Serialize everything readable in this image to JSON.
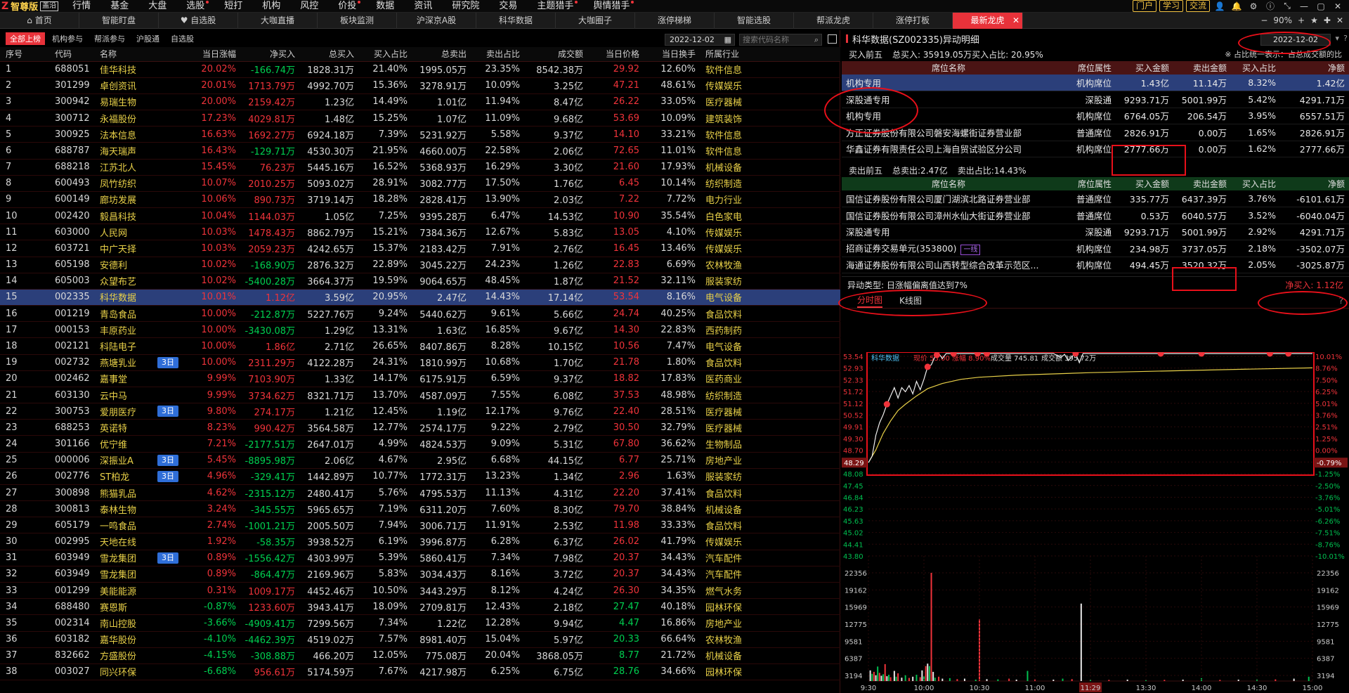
{
  "app": {
    "logo_mark": "Z",
    "name": "智尊版",
    "version": "盖沿"
  },
  "menu": [
    {
      "label": "行情",
      "dot": false
    },
    {
      "label": "基金",
      "dot": false
    },
    {
      "label": "大盘",
      "dot": false
    },
    {
      "label": "选股",
      "dot": true
    },
    {
      "label": "短打",
      "dot": false
    },
    {
      "label": "机构",
      "dot": false
    },
    {
      "label": "风控",
      "dot": false
    },
    {
      "label": "价投",
      "dot": true
    },
    {
      "label": "数据",
      "dot": false
    },
    {
      "label": "资讯",
      "dot": false
    },
    {
      "label": "研究院",
      "dot": false
    },
    {
      "label": "交易",
      "dot": false
    },
    {
      "label": "主题猎手",
      "dot": true
    },
    {
      "label": "舆情猎手",
      "dot": true
    }
  ],
  "menu_right": {
    "portal": "门户",
    "learn": "学习",
    "exchange": "交流"
  },
  "tabs": [
    "首页",
    "智能盯盘",
    "自选股",
    "大咖直播",
    "板块监测",
    "沪深京A股",
    "科华数据",
    "大咖圈子",
    "涨停梯梯",
    "智能选股",
    "帮派龙虎",
    "涨停打板",
    "最新龙虎"
  ],
  "tabbar_right": {
    "zoom": "90%"
  },
  "left": {
    "subtabs": [
      "全部上榜",
      "机构参与",
      "帮派参与",
      "沪股通",
      "自选股"
    ],
    "date": "2022-12-02",
    "search_placeholder": "搜索代码名称",
    "columns": [
      "序号",
      "代码",
      "名称",
      "当日涨幅",
      "净买入",
      "总买入",
      "买入占比",
      "总卖出",
      "卖出占比",
      "成交额",
      "当日价格",
      "当日换手",
      "所属行业"
    ],
    "rows": [
      [
        "1",
        "688051",
        "佳华科技",
        "",
        "20.02%",
        "-166.74万",
        "1828.31万",
        "21.40%",
        "1995.05万",
        "23.35%",
        "8542.38万",
        "29.92",
        "12.60%",
        "软件信息"
      ],
      [
        "2",
        "301299",
        "卓创资讯",
        "",
        "20.01%",
        "1713.79万",
        "4992.70万",
        "15.36%",
        "3278.91万",
        "10.09%",
        "3.25亿",
        "47.21",
        "48.61%",
        "传媒娱乐"
      ],
      [
        "3",
        "300942",
        "易瑞生物",
        "",
        "20.00%",
        "2159.42万",
        "1.23亿",
        "14.49%",
        "1.01亿",
        "11.94%",
        "8.47亿",
        "26.22",
        "33.05%",
        "医疗器械"
      ],
      [
        "4",
        "300712",
        "永福股份",
        "",
        "17.23%",
        "4029.81万",
        "1.48亿",
        "15.25%",
        "1.07亿",
        "11.09%",
        "9.68亿",
        "53.69",
        "10.09%",
        "建筑装饰"
      ],
      [
        "5",
        "300925",
        "法本信息",
        "",
        "16.63%",
        "1692.27万",
        "6924.18万",
        "7.39%",
        "5231.92万",
        "5.58%",
        "9.37亿",
        "14.10",
        "33.21%",
        "软件信息"
      ],
      [
        "6",
        "688787",
        "海天瑞声",
        "",
        "16.43%",
        "-129.71万",
        "4530.30万",
        "21.95%",
        "4660.00万",
        "22.58%",
        "2.06亿",
        "72.65",
        "11.01%",
        "软件信息"
      ],
      [
        "7",
        "688218",
        "江苏北人",
        "",
        "15.45%",
        "76.23万",
        "5445.16万",
        "16.52%",
        "5368.93万",
        "16.29%",
        "3.30亿",
        "21.60",
        "17.93%",
        "机械设备"
      ],
      [
        "8",
        "600493",
        "凤竹纺织",
        "",
        "10.07%",
        "2010.25万",
        "5093.02万",
        "28.91%",
        "3082.77万",
        "17.50%",
        "1.76亿",
        "6.45",
        "10.14%",
        "纺织制造"
      ],
      [
        "9",
        "600149",
        "廊坊发展",
        "",
        "10.06%",
        "890.73万",
        "3719.14万",
        "18.28%",
        "2828.41万",
        "13.90%",
        "2.03亿",
        "7.22",
        "7.72%",
        "电力行业"
      ],
      [
        "10",
        "002420",
        "毅昌科技",
        "",
        "10.04%",
        "1144.03万",
        "1.05亿",
        "7.25%",
        "9395.28万",
        "6.47%",
        "14.53亿",
        "10.90",
        "35.54%",
        "白色家电"
      ],
      [
        "11",
        "603000",
        "人民网",
        "",
        "10.03%",
        "1478.43万",
        "8862.79万",
        "15.21%",
        "7384.36万",
        "12.67%",
        "5.83亿",
        "13.05",
        "4.10%",
        "传媒娱乐"
      ],
      [
        "12",
        "603721",
        "中广天择",
        "",
        "10.03%",
        "2059.23万",
        "4242.65万",
        "15.37%",
        "2183.42万",
        "7.91%",
        "2.76亿",
        "16.45",
        "13.46%",
        "传媒娱乐"
      ],
      [
        "13",
        "605198",
        "安德利",
        "",
        "10.02%",
        "-168.90万",
        "2876.32万",
        "22.89%",
        "3045.22万",
        "24.23%",
        "1.26亿",
        "22.83",
        "6.69%",
        "农林牧渔"
      ],
      [
        "14",
        "605003",
        "众望布艺",
        "",
        "10.02%",
        "-5400.28万",
        "3664.37万",
        "19.59%",
        "9064.65万",
        "48.45%",
        "1.87亿",
        "21.52",
        "32.11%",
        "服装家纺"
      ],
      [
        "15",
        "002335",
        "科华数据",
        "",
        "10.01%",
        "1.12亿",
        "3.59亿",
        "20.95%",
        "2.47亿",
        "14.43%",
        "17.14亿",
        "53.54",
        "8.16%",
        "电气设备"
      ],
      [
        "16",
        "001219",
        "青岛食品",
        "",
        "10.00%",
        "-212.87万",
        "5227.76万",
        "9.24%",
        "5440.62万",
        "9.61%",
        "5.66亿",
        "24.74",
        "40.25%",
        "食品饮料"
      ],
      [
        "17",
        "000153",
        "丰原药业",
        "",
        "10.00%",
        "-3430.08万",
        "1.29亿",
        "13.31%",
        "1.63亿",
        "16.85%",
        "9.67亿",
        "14.30",
        "22.83%",
        "西药制药"
      ],
      [
        "18",
        "002121",
        "科陆电子",
        "",
        "10.00%",
        "1.86亿",
        "2.71亿",
        "26.65%",
        "8407.86万",
        "8.28%",
        "10.15亿",
        "10.56",
        "7.47%",
        "电气设备"
      ],
      [
        "19",
        "002732",
        "燕塘乳业",
        "3日",
        "10.00%",
        "2311.29万",
        "4122.28万",
        "24.31%",
        "1810.99万",
        "10.68%",
        "1.70亿",
        "21.78",
        "1.80%",
        "食品饮料"
      ],
      [
        "20",
        "002462",
        "嘉事堂",
        "",
        "9.99%",
        "7103.90万",
        "1.33亿",
        "14.17%",
        "6175.91万",
        "6.59%",
        "9.37亿",
        "18.82",
        "17.83%",
        "医药商业"
      ],
      [
        "21",
        "603130",
        "云中马",
        "",
        "9.99%",
        "3734.62万",
        "8321.71万",
        "13.70%",
        "4587.09万",
        "7.55%",
        "6.08亿",
        "37.53",
        "48.98%",
        "纺织制造"
      ],
      [
        "22",
        "300753",
        "爱朋医疗",
        "3日",
        "9.80%",
        "274.17万",
        "1.21亿",
        "12.45%",
        "1.19亿",
        "12.17%",
        "9.76亿",
        "22.40",
        "28.51%",
        "医疗器械"
      ],
      [
        "23",
        "688253",
        "英诺特",
        "",
        "8.23%",
        "990.42万",
        "3564.58万",
        "12.77%",
        "2574.17万",
        "9.22%",
        "2.79亿",
        "30.50",
        "32.79%",
        "医疗器械"
      ],
      [
        "24",
        "301166",
        "优宁维",
        "",
        "7.21%",
        "-2177.51万",
        "2647.01万",
        "4.99%",
        "4824.53万",
        "9.09%",
        "5.31亿",
        "67.80",
        "36.62%",
        "生物制品"
      ],
      [
        "25",
        "000006",
        "深振业A",
        "3日",
        "5.45%",
        "-8895.98万",
        "2.06亿",
        "4.67%",
        "2.95亿",
        "6.68%",
        "44.15亿",
        "6.77",
        "25.71%",
        "房地产业"
      ],
      [
        "26",
        "002776",
        "ST柏龙",
        "3日",
        "4.96%",
        "-329.41万",
        "1442.89万",
        "10.77%",
        "1772.31万",
        "13.23%",
        "1.34亿",
        "2.96",
        "1.63%",
        "服装家纺"
      ],
      [
        "27",
        "300898",
        "熊猫乳品",
        "",
        "4.62%",
        "-2315.12万",
        "2480.41万",
        "5.76%",
        "4795.53万",
        "11.13%",
        "4.31亿",
        "22.20",
        "37.41%",
        "食品饮料"
      ],
      [
        "28",
        "300813",
        "泰林生物",
        "",
        "3.24%",
        "-345.55万",
        "5965.65万",
        "7.19%",
        "6311.20万",
        "7.60%",
        "8.30亿",
        "79.70",
        "38.84%",
        "机械设备"
      ],
      [
        "29",
        "605179",
        "一鸣食品",
        "",
        "2.74%",
        "-1001.21万",
        "2005.50万",
        "7.94%",
        "3006.71万",
        "11.91%",
        "2.53亿",
        "11.98",
        "33.33%",
        "食品饮料"
      ],
      [
        "30",
        "002995",
        "天地在线",
        "",
        "1.92%",
        "-58.35万",
        "3938.52万",
        "6.19%",
        "3996.87万",
        "6.28%",
        "6.37亿",
        "26.02",
        "41.79%",
        "传媒娱乐"
      ],
      [
        "31",
        "603949",
        "雪龙集团",
        "3日",
        "0.89%",
        "-1556.42万",
        "4303.99万",
        "5.39%",
        "5860.41万",
        "7.34%",
        "7.98亿",
        "20.37",
        "34.43%",
        "汽车配件"
      ],
      [
        "32",
        "603949",
        "雪龙集团",
        "",
        "0.89%",
        "-864.47万",
        "2169.96万",
        "5.83%",
        "3034.43万",
        "8.16%",
        "3.72亿",
        "20.37",
        "34.43%",
        "汽车配件"
      ],
      [
        "33",
        "001299",
        "美能能源",
        "",
        "0.31%",
        "1009.17万",
        "4452.46万",
        "10.50%",
        "3443.29万",
        "8.12%",
        "4.24亿",
        "26.30",
        "34.35%",
        "燃气水务"
      ],
      [
        "34",
        "688480",
        "赛恩斯",
        "",
        "-0.87%",
        "1233.60万",
        "3943.41万",
        "18.09%",
        "2709.81万",
        "12.43%",
        "2.18亿",
        "27.47",
        "40.18%",
        "园林环保"
      ],
      [
        "35",
        "002314",
        "南山控股",
        "",
        "-3.66%",
        "-4909.41万",
        "7299.56万",
        "7.34%",
        "1.22亿",
        "12.28%",
        "9.94亿",
        "4.47",
        "16.86%",
        "房地产业"
      ],
      [
        "36",
        "603182",
        "嘉华股份",
        "",
        "-4.10%",
        "-4462.39万",
        "4519.02万",
        "7.57%",
        "8981.40万",
        "15.04%",
        "5.97亿",
        "20.33",
        "66.64%",
        "农林牧渔"
      ],
      [
        "37",
        "832662",
        "方盛股份",
        "",
        "-4.15%",
        "-308.88万",
        "466.20万",
        "12.05%",
        "775.08万",
        "20.04%",
        "3868.05万",
        "8.77",
        "21.72%",
        "机械设备"
      ],
      [
        "38",
        "003027",
        "同兴环保",
        "",
        "-6.68%",
        "956.61万",
        "5174.59万",
        "7.67%",
        "4217.98万",
        "6.25%",
        "6.75亿",
        "28.76",
        "34.66%",
        "园林环保"
      ]
    ],
    "selected_row": 15
  },
  "right": {
    "title": "科华数据(SZ002335)异动明细",
    "date": "2022-12-02",
    "buy_top5_label": "买入前五",
    "buy_summary": "总买入: 35919.05万买入占比: 20.95%",
    "ratio_note": "※ 占比统一表示：占总成交额的比",
    "seat_columns": [
      "席位名称",
      "席位属性",
      "买入金额",
      "卖出金额",
      "买入占比",
      "净额"
    ],
    "buy_rows": [
      [
        "机构专用",
        "机构席位",
        "1.43亿",
        "11.14万",
        "8.32%",
        "1.42亿"
      ],
      [
        "深股通专用",
        "深股通",
        "9293.71万",
        "5001.99万",
        "5.42%",
        "4291.71万"
      ],
      [
        "机构专用",
        "机构席位",
        "6764.05万",
        "206.54万",
        "3.95%",
        "6557.51万"
      ],
      [
        "方正证券股份有限公司磐安海螺街证券营业部",
        "普通席位",
        "2826.91万",
        "0.00万",
        "1.65%",
        "2826.91万"
      ],
      [
        "华鑫证券有限责任公司上海自贸试验区分公司",
        "机构席位",
        "2777.66万",
        "0.00万",
        "1.62%",
        "2777.66万"
      ]
    ],
    "sell_top5_label": "卖出前五",
    "sell_summary_total": "总卖出:2.47亿",
    "sell_summary_ratio": "卖出占比:14.43%",
    "sell_rows": [
      [
        "国信证券股份有限公司厦门湖滨北路证券营业部",
        "",
        "普通席位",
        "335.77万",
        "6437.39万",
        "3.76%",
        "-6101.61万"
      ],
      [
        "国信证券股份有限公司漳州水仙大街证券营业部",
        "",
        "普通席位",
        "0.53万",
        "6040.57万",
        "3.52%",
        "-6040.04万"
      ],
      [
        "深股通专用",
        "",
        "深股通",
        "9293.71万",
        "5001.99万",
        "2.92%",
        "4291.71万"
      ],
      [
        "招商证券交易单元(353800)",
        "一线",
        "机构席位",
        "234.98万",
        "3737.05万",
        "2.18%",
        "-3502.07万"
      ],
      [
        "海通证券股份有限公司山西转型综合改革示范区...",
        "",
        "机构席位",
        "494.45万",
        "3520.32万",
        "2.05%",
        "-3025.87万"
      ]
    ],
    "anomaly_type": "异动类型: 日涨幅偏离值达到7%",
    "net_buy": "净买入: 1.12亿",
    "chart_tabs": [
      "分时图",
      "K线图"
    ]
  },
  "chart_data": {
    "type": "line",
    "stock_name": "科华数据",
    "price_label": "现价",
    "price": "53.00",
    "change_label": "涨幅",
    "change": "8.90%",
    "volume_label": "成交量",
    "volume": "745.81",
    "amount_label": "成交额",
    "amount": "395.72万",
    "price_ticks_left": [
      "53.54",
      "52.93",
      "52.33",
      "51.72",
      "51.12",
      "50.52",
      "49.91",
      "49.30",
      "48.70",
      "48.29",
      "48.08",
      "47.45",
      "46.84",
      "46.23",
      "45.63",
      "45.02",
      "44.41",
      "43.80"
    ],
    "price_ticks_right": [
      "10.01%",
      "8.76%",
      "7.50%",
      "6.25%",
      "5.01%",
      "3.76%",
      "2.51%",
      "1.25%",
      "0.00%",
      "-0.79%",
      "-1.25%",
      "-2.50%",
      "-3.76%",
      "-5.01%",
      "-6.26%",
      "-7.51%",
      "-8.76%",
      "-10.01%"
    ],
    "ylim": [
      43.8,
      53.54
    ],
    "volume_ticks": [
      "22356",
      "19162",
      "15969",
      "12775",
      "9581",
      "6387",
      "3194"
    ],
    "time_ticks": [
      "9:30",
      "10:00",
      "10:30",
      "11:00",
      "11:29",
      "13:30",
      "14:00",
      "14:30",
      "15:00"
    ],
    "highlight_time": "11:29",
    "cursor_price": "48.29",
    "cursor_pct": "-0.79%",
    "price_series": [
      [
        0,
        48.29
      ],
      [
        2,
        48.6
      ],
      [
        4,
        49.6
      ],
      [
        6,
        50.2
      ],
      [
        8,
        50.6
      ],
      [
        10,
        51.1
      ],
      [
        12,
        51.5
      ],
      [
        14,
        51.9
      ],
      [
        16,
        51.4
      ],
      [
        18,
        51.9
      ],
      [
        20,
        51.7
      ],
      [
        22,
        52.0
      ],
      [
        24,
        51.6
      ],
      [
        26,
        52.2
      ],
      [
        28,
        51.8
      ],
      [
        30,
        52.3
      ],
      [
        32,
        52.9
      ],
      [
        34,
        53.0
      ],
      [
        36,
        53.4
      ],
      [
        38,
        53.54
      ],
      [
        40,
        53.3
      ],
      [
        42,
        53.54
      ],
      [
        50,
        53.54
      ],
      [
        60,
        53.54
      ],
      [
        70,
        53.54
      ],
      [
        80,
        53.54
      ],
      [
        90,
        53.54
      ],
      [
        100,
        53.54
      ],
      [
        104,
        53.35
      ],
      [
        106,
        53.5
      ],
      [
        108,
        53.2
      ],
      [
        110,
        53.4
      ],
      [
        112,
        53.54
      ],
      [
        114,
        53.1
      ],
      [
        116,
        53.54
      ],
      [
        120,
        53.54
      ],
      [
        140,
        53.54
      ],
      [
        160,
        53.54
      ],
      [
        180,
        53.54
      ],
      [
        200,
        53.54
      ],
      [
        220,
        53.54
      ],
      [
        240,
        53.54
      ]
    ],
    "avg_series": [
      [
        0,
        48.29
      ],
      [
        4,
        48.9
      ],
      [
        8,
        49.7
      ],
      [
        12,
        50.3
      ],
      [
        16,
        50.8
      ],
      [
        20,
        51.1
      ],
      [
        26,
        51.5
      ],
      [
        32,
        51.85
      ],
      [
        40,
        52.1
      ],
      [
        50,
        52.3
      ],
      [
        60,
        52.4
      ],
      [
        80,
        52.5
      ],
      [
        120,
        52.62
      ],
      [
        160,
        52.7
      ],
      [
        200,
        52.78
      ],
      [
        240,
        52.85
      ]
    ],
    "red_dots": [
      10,
      32,
      37,
      46,
      59,
      64,
      112,
      158,
      180,
      217,
      227
    ],
    "volume_bars": [
      [
        1,
        2200
      ],
      [
        2,
        1500
      ],
      [
        3,
        1900
      ],
      [
        4,
        1200
      ],
      [
        5,
        3000
      ],
      [
        6,
        1700
      ],
      [
        7,
        1100
      ],
      [
        8,
        1400
      ],
      [
        9,
        3500
      ],
      [
        10,
        1000
      ],
      [
        11,
        1300
      ],
      [
        12,
        800
      ],
      [
        14,
        2100
      ],
      [
        15,
        900
      ],
      [
        16,
        1600
      ],
      [
        18,
        700
      ],
      [
        20,
        1200
      ],
      [
        22,
        650
      ],
      [
        24,
        900
      ],
      [
        26,
        1300
      ],
      [
        28,
        800
      ],
      [
        29,
        2200
      ],
      [
        30,
        1000
      ],
      [
        31,
        3100
      ],
      [
        32,
        3600
      ],
      [
        33,
        3100
      ],
      [
        34,
        22356
      ],
      [
        35,
        1900
      ],
      [
        36,
        700
      ],
      [
        38,
        900
      ],
      [
        40,
        500
      ],
      [
        44,
        600
      ],
      [
        48,
        400
      ],
      [
        52,
        500
      ],
      [
        58,
        300
      ],
      [
        60,
        12800
      ],
      [
        64,
        400
      ],
      [
        70,
        350
      ],
      [
        76,
        500
      ],
      [
        80,
        300
      ],
      [
        86,
        2100
      ],
      [
        90,
        400
      ],
      [
        100,
        300
      ],
      [
        105,
        500
      ],
      [
        110,
        400
      ],
      [
        115,
        16000
      ],
      [
        120,
        300
      ],
      [
        130,
        250
      ],
      [
        140,
        300
      ],
      [
        150,
        200
      ],
      [
        160,
        250
      ],
      [
        170,
        300
      ],
      [
        180,
        600
      ],
      [
        190,
        250
      ],
      [
        200,
        300
      ],
      [
        210,
        400
      ],
      [
        220,
        350
      ],
      [
        230,
        500
      ],
      [
        238,
        900
      ]
    ]
  }
}
